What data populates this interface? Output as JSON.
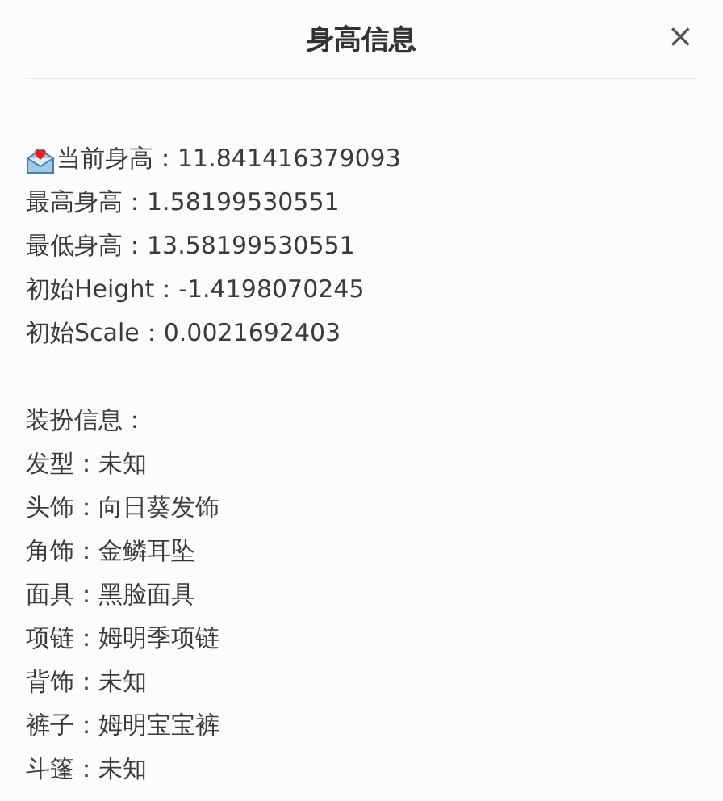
{
  "dialog": {
    "title": "身高信息",
    "close": "×"
  },
  "height_lines": [
    "当前身高：11.841416379093",
    "最高身高：1.58199530551",
    "最低身高：13.58199530551",
    "初始Height：-1.4198070245",
    "初始Scale：0.0021692403"
  ],
  "outfit_heading": "装扮信息：",
  "outfit_lines": [
    "发型：未知",
    "头饰：向日葵发饰",
    "角饰：金鳞耳坠",
    "面具：黑脸面具",
    "项链：姆明季项链",
    "背饰：未知",
    "裤子：姆明宝宝裤",
    "斗篷：未知"
  ]
}
